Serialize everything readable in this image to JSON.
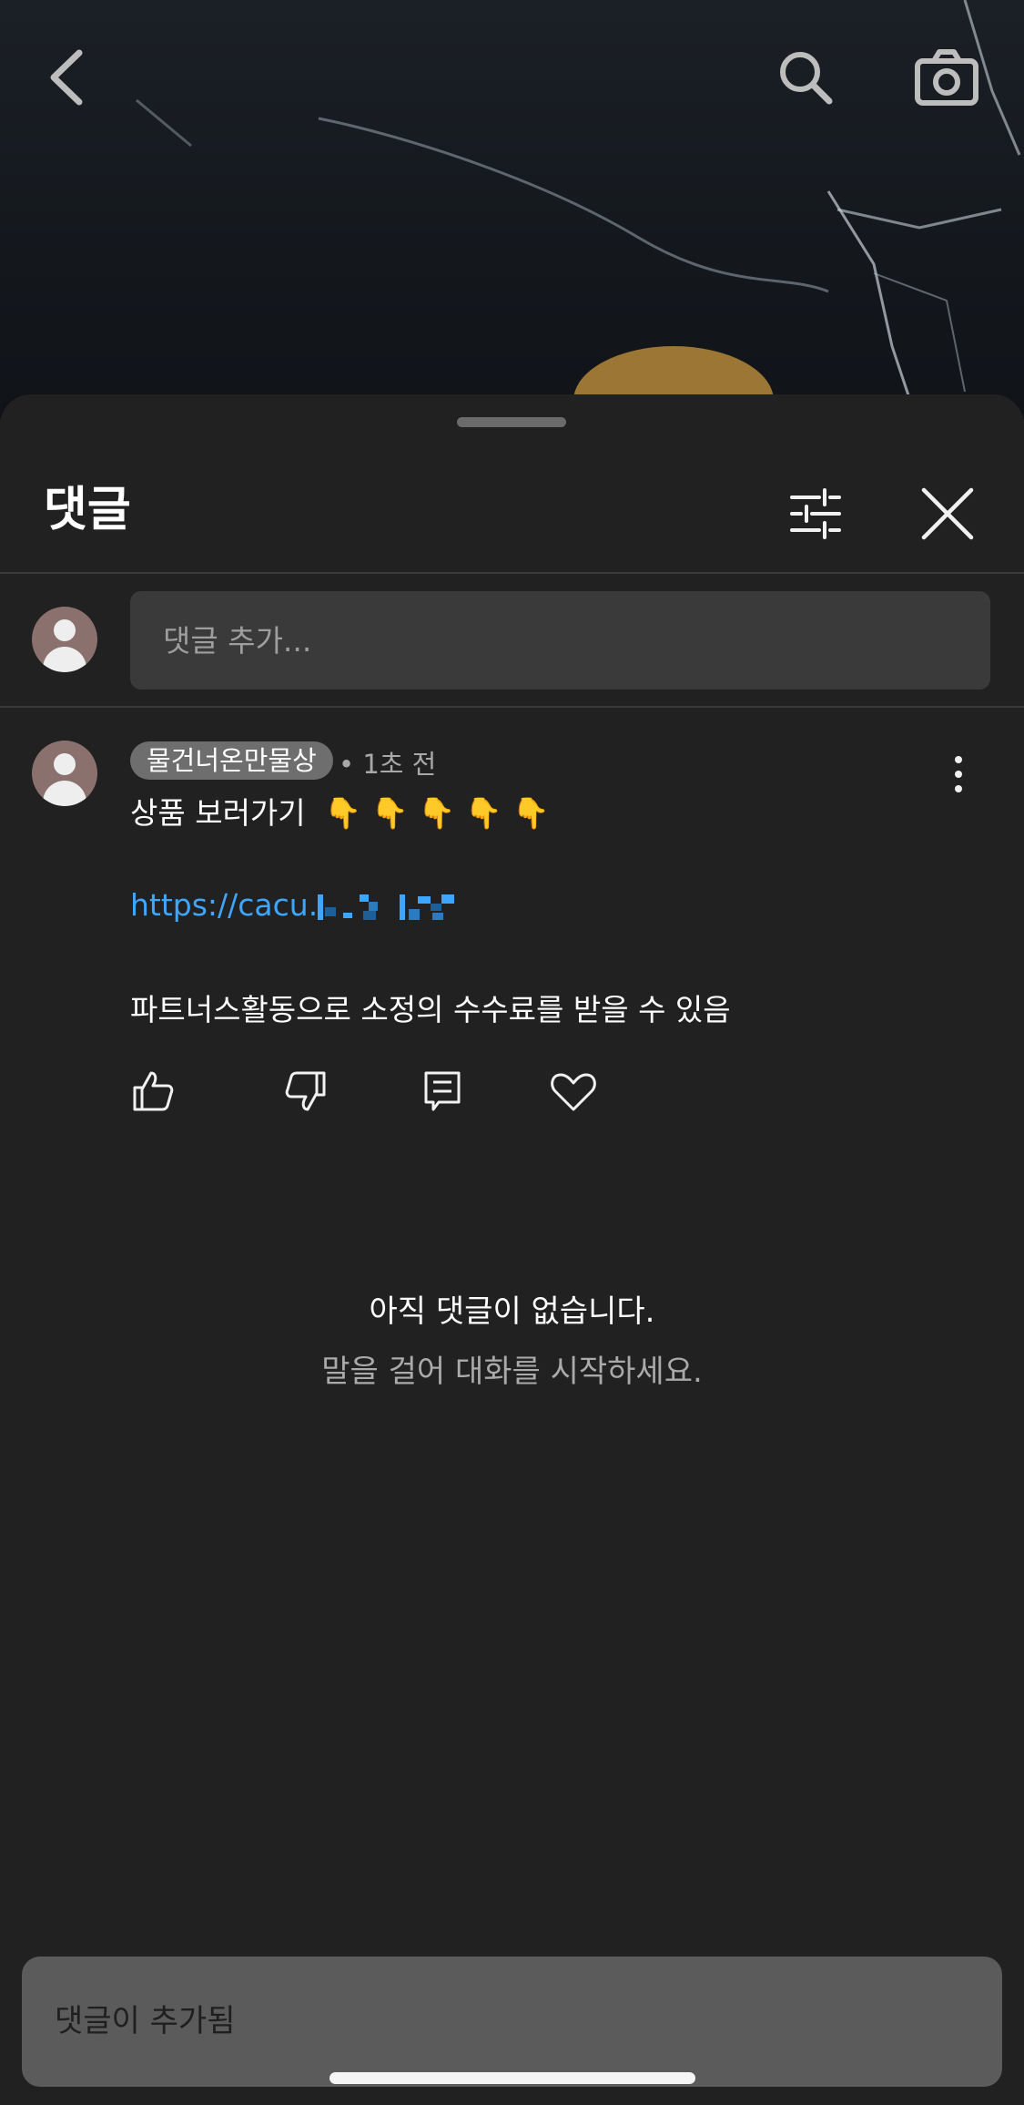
{
  "header": {
    "title": "댓글"
  },
  "add_comment": {
    "placeholder": "댓글 추가..."
  },
  "comment": {
    "author": "물건너온만물상",
    "time": "• 1초 전",
    "line1": "상품 보러가기",
    "emoji": "👇 👇 👇 👇 👇",
    "link_text": "https://cacu.",
    "line3": "파트너스활동으로 소정의 수수료를 받을 수 있음"
  },
  "empty_state": {
    "title": "아직 댓글이 없습니다.",
    "subtitle": "말을 걸어 대화를 시작하세요."
  },
  "toast": {
    "message": "댓글이 추가됨"
  },
  "colors": {
    "sheet_bg": "#212121",
    "link": "#3ea6ff",
    "avatar": "#8a716d"
  },
  "icons": [
    "back-arrow-icon",
    "search-icon",
    "camera-icon",
    "filter-sliders-icon",
    "close-icon",
    "more-vertical-icon",
    "like-icon",
    "dislike-icon",
    "reply-icon",
    "heart-icon"
  ]
}
